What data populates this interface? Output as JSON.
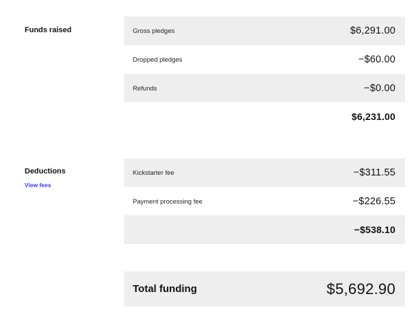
{
  "funds_raised": {
    "title": "Funds raised",
    "rows": [
      {
        "label": "Gross pledges",
        "amount": "$6,291.00"
      },
      {
        "label": "Dropped pledges",
        "amount": "−$60.00"
      },
      {
        "label": "Refunds",
        "amount": "−$0.00"
      }
    ],
    "subtotal": "$6,231.00"
  },
  "deductions": {
    "title": "Deductions",
    "link_label": "View fees",
    "rows": [
      {
        "label": "Kickstarter fee",
        "amount": "−$311.55"
      },
      {
        "label": "Payment processing fee",
        "amount": "−$226.55"
      }
    ],
    "subtotal": "−$538.10"
  },
  "total": {
    "label": "Total funding",
    "amount": "$5,692.90"
  },
  "colors": {
    "row_background": "#eeeeee",
    "link": "#2b3cff",
    "text": "#111111"
  }
}
